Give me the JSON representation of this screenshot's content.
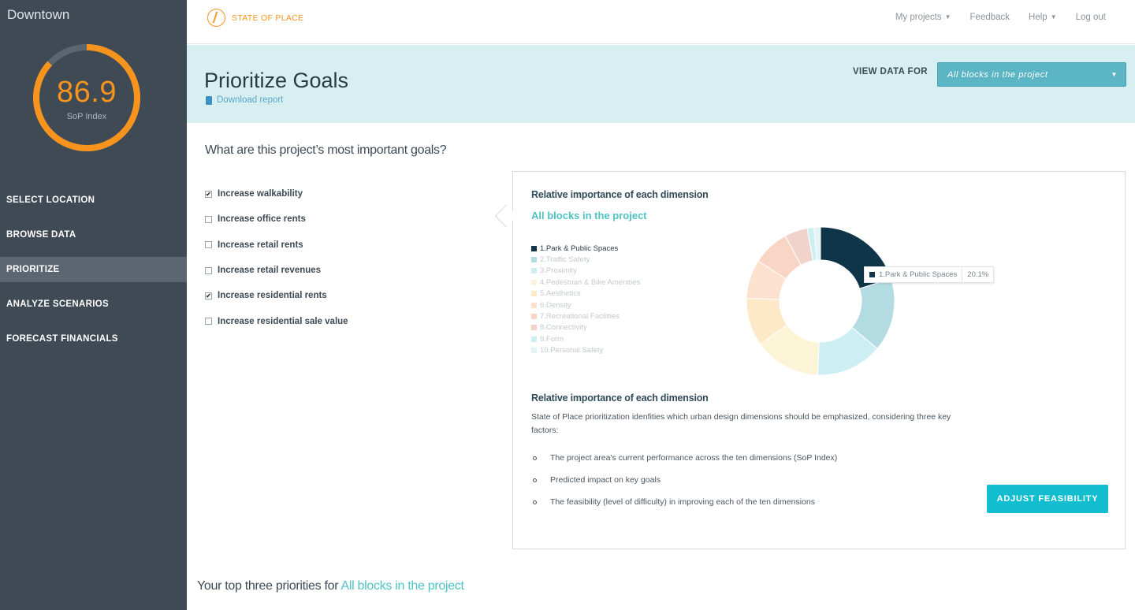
{
  "sidebar": {
    "project_name": "Downtown",
    "score": "86.9",
    "score_label": "SoP Index",
    "score_fraction": 0.869,
    "items": [
      {
        "label": "SELECT LOCATION",
        "active": false
      },
      {
        "label": "BROWSE DATA",
        "active": false
      },
      {
        "label": "PRIORITIZE",
        "active": true
      },
      {
        "label": "ANALYZE SCENARIOS",
        "active": false
      },
      {
        "label": "FORECAST FINANCIALS",
        "active": false
      }
    ]
  },
  "header": {
    "logo_text": "STATE OF PLACE",
    "nav": {
      "my_projects": "My projects",
      "feedback": "Feedback",
      "help": "Help",
      "logout": "Log out"
    }
  },
  "banner": {
    "title": "Prioritize Goals",
    "download": "Download report",
    "view_data_label": "VIEW DATA FOR",
    "view_data_value": "All blocks in the project"
  },
  "goals": {
    "title": "What are this project’s most important goals?",
    "items": [
      {
        "label": "Increase walkability",
        "checked": true
      },
      {
        "label": "Increase office rents",
        "checked": false
      },
      {
        "label": "Increase retail rents",
        "checked": false
      },
      {
        "label": "Increase retail revenues",
        "checked": false
      },
      {
        "label": "Increase residential rents",
        "checked": true
      },
      {
        "label": "Increase residential sale value",
        "checked": false
      }
    ]
  },
  "card": {
    "title": "Relative importance of each dimension",
    "subtitle": "All blocks in the project",
    "tooltip": {
      "name": "1.Park & Public Spaces",
      "value": "20.1%"
    },
    "desc_title": "Relative importance of each dimension",
    "desc": "State of Place prioritization idenfities which urban design dimensions should be emphasized, considering three key factors:",
    "bullets": [
      "The project area's current performance across the ten dimensions (SoP Index)",
      "Predicted impact on key goals",
      "The feasibility (level of difficulty) in improving each of the ten dimensions"
    ],
    "adjust_button": "ADJUST FEASIBILITY"
  },
  "chart_data": {
    "type": "pie",
    "categories": [
      "1.Park & Public Spaces",
      "2.Traffic Safety",
      "3.Proximity",
      "4.Pedestrian & Bike Amenities",
      "5.Aesthetics",
      "6.Density",
      "7.Recreational Facilities",
      "8.Connectivity",
      "9.Form",
      "10.Personal Safety"
    ],
    "values": [
      20.1,
      16.0,
      14.5,
      14.5,
      10.5,
      8.5,
      8.0,
      5.0,
      1.5,
      1.4
    ],
    "colors": [
      "#0f3548",
      "#b3dce2",
      "#cdeef2",
      "#fbf4d6",
      "#fde8c8",
      "#fde1cf",
      "#f9d5c6",
      "#f0d3ca",
      "#cdeef2",
      "#e4f4f6"
    ],
    "active_index": 0,
    "legend_position": "left"
  },
  "bottom": {
    "prefix": "Your top three priorities for",
    "highlight": "All blocks in the project"
  }
}
